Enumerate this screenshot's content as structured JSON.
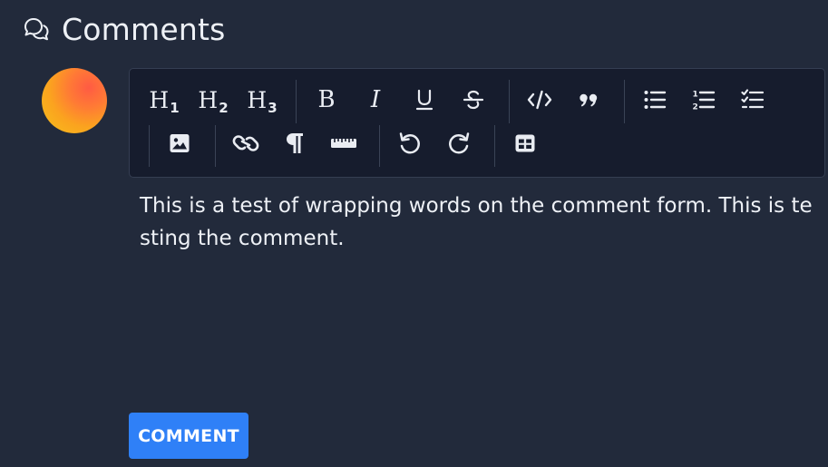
{
  "header": {
    "title": "Comments",
    "icon": "chat-bubbles-icon"
  },
  "avatar": {
    "colors": [
      "#f6c11a",
      "#fba31f",
      "#ff5b43"
    ]
  },
  "toolbar": {
    "row1": [
      {
        "name": "heading-1",
        "icon": "heading-1-icon",
        "label": "H",
        "sub": "1"
      },
      {
        "name": "heading-2",
        "icon": "heading-2-icon",
        "label": "H",
        "sub": "2"
      },
      {
        "name": "heading-3",
        "icon": "heading-3-icon",
        "label": "H",
        "sub": "3"
      },
      {
        "name": "bold",
        "icon": "bold-icon",
        "label": "B"
      },
      {
        "name": "italic",
        "icon": "italic-icon",
        "label": "I"
      },
      {
        "name": "underline",
        "icon": "underline-icon"
      },
      {
        "name": "strikethrough",
        "icon": "strikethrough-icon"
      },
      {
        "name": "code",
        "icon": "code-icon"
      },
      {
        "name": "blockquote",
        "icon": "quote-icon"
      },
      {
        "name": "bullet-list",
        "icon": "bullet-list-icon"
      },
      {
        "name": "ordered-list",
        "icon": "ordered-list-icon"
      },
      {
        "name": "task-list",
        "icon": "task-list-icon"
      }
    ],
    "row2": [
      {
        "name": "image",
        "icon": "image-icon"
      },
      {
        "name": "link",
        "icon": "link-icon"
      },
      {
        "name": "paragraph",
        "icon": "paragraph-icon"
      },
      {
        "name": "horizontal-rule",
        "icon": "ruler-icon"
      },
      {
        "name": "undo",
        "icon": "undo-icon"
      },
      {
        "name": "redo",
        "icon": "redo-icon"
      },
      {
        "name": "table",
        "icon": "table-icon"
      }
    ]
  },
  "editor": {
    "content": "This is a test of wrapping words on the comment form. This is testing the comment."
  },
  "submit": {
    "label": "COMMENT",
    "color": "#2f80f7"
  },
  "theme": {
    "background": "#222a3b",
    "toolbar_background": "#161c2d"
  }
}
